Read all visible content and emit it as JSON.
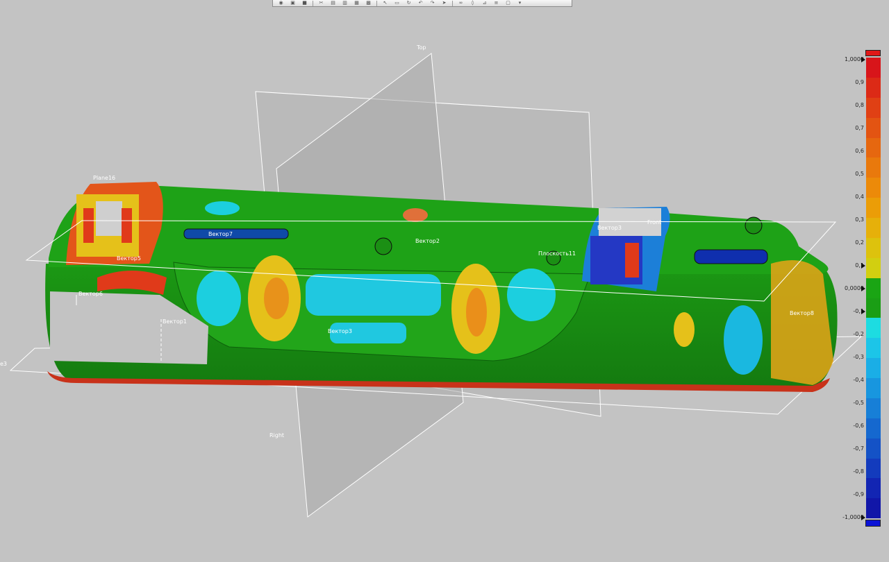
{
  "toolbar": {
    "buttons": [
      "view-icon",
      "box-icon",
      "color-icon",
      "cut-icon",
      "print-icon",
      "print2-icon",
      "columns-icon",
      "save-icon",
      "pointer-icon",
      "select-icon",
      "rotate-icon",
      "undo-icon",
      "redo-icon",
      "cursor-icon",
      "link-icon",
      "shield-icon",
      "measure-icon",
      "align-icon",
      "window-icon",
      "more-icon"
    ]
  },
  "scene": {
    "labels": {
      "top": "Top",
      "right": "Right",
      "front": "Front",
      "plane16": "Plane16",
      "plane3_partial": "e3",
      "vector1": "Вектор1",
      "vector2": "Вектор2",
      "vector3_bottom": "Вектор3",
      "vector3_top": "Вектор3",
      "vector5": "Вектор5",
      "vector6": "Вектор6",
      "vector7": "Вектор7",
      "vector8": "Вектор8",
      "plane11": "Плоскость11"
    }
  },
  "legend": {
    "max_label": "1,0000",
    "min_label": "-1,0000",
    "ticks": [
      "0,9",
      "0,8",
      "0,7",
      "0,6",
      "0,5",
      "0,4",
      "0,3",
      "0,2",
      "0,1",
      "0,0000",
      "-0,1",
      "-0,2",
      "-0,3",
      "-0,4",
      "-0,5",
      "-0,6",
      "-0,7",
      "-0,8",
      "-0,9"
    ],
    "colors": [
      "#d8151a",
      "#dc2a16",
      "#e04014",
      "#e35412",
      "#e6670f",
      "#e9790c",
      "#ec8a09",
      "#eb9d07",
      "#e6b00a",
      "#ddc20d",
      "#d2cf10",
      "#1aa514",
      "#1a9e15",
      "#1ddce1",
      "#1cc5e8",
      "#1aaee6",
      "#1896df",
      "#177fd7",
      "#1568cf",
      "#1452c6",
      "#133bbd",
      "#1225b3",
      "#1116a8"
    ]
  }
}
